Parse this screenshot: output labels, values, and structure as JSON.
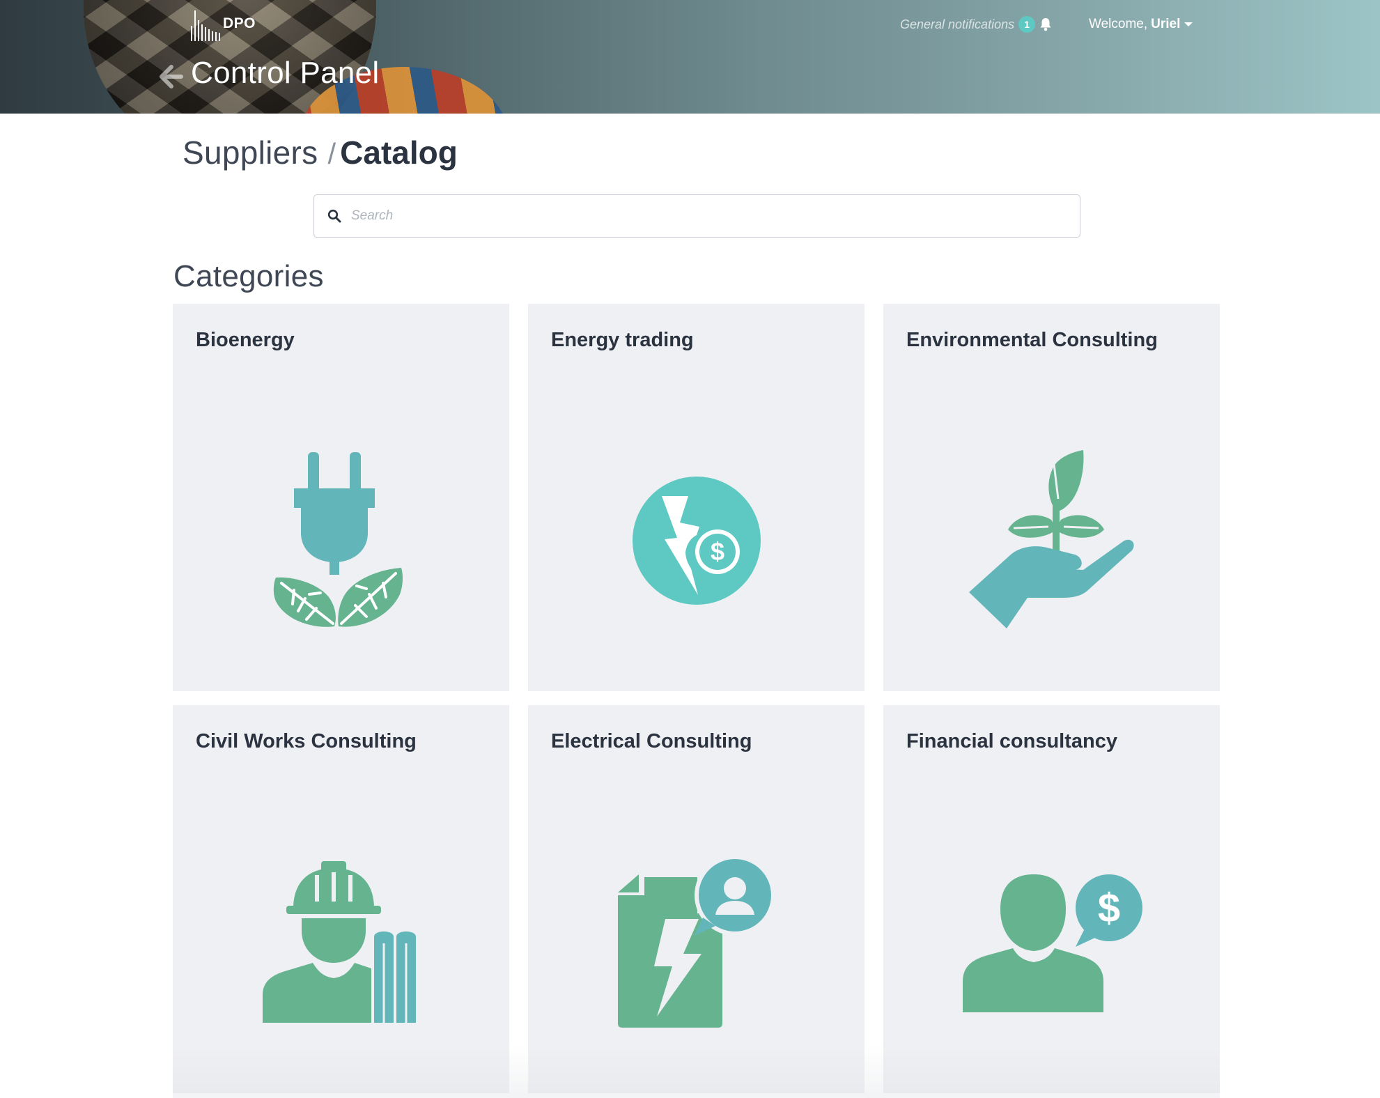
{
  "header": {
    "logo_text": "DPO",
    "title": "Control Panel",
    "notifications_label": "General notifications",
    "notifications_count": "1",
    "welcome_prefix": "Welcome,",
    "user_name": "Uriel"
  },
  "breadcrumb": {
    "parent": "Suppliers",
    "separator": "/",
    "current": "Catalog"
  },
  "search": {
    "placeholder": "Search"
  },
  "categories": {
    "title": "Categories",
    "items": [
      {
        "label": "Bioenergy",
        "icon": "plug-leaves-icon"
      },
      {
        "label": "Energy trading",
        "icon": "lightning-dollar-icon"
      },
      {
        "label": "Environmental Consulting",
        "icon": "hand-sprout-icon"
      },
      {
        "label": "Civil Works Consulting",
        "icon": "construction-worker-icon"
      },
      {
        "label": "Electrical Consulting",
        "icon": "electric-document-user-icon"
      },
      {
        "label": "Financial consultancy",
        "icon": "person-dollar-bubble-icon"
      }
    ]
  },
  "colors": {
    "teal": "#5ec8c2",
    "teal_dark": "#62b6b9",
    "green": "#65b38f",
    "card_bg": "#eff0f3",
    "text_dark": "#2b3340"
  }
}
